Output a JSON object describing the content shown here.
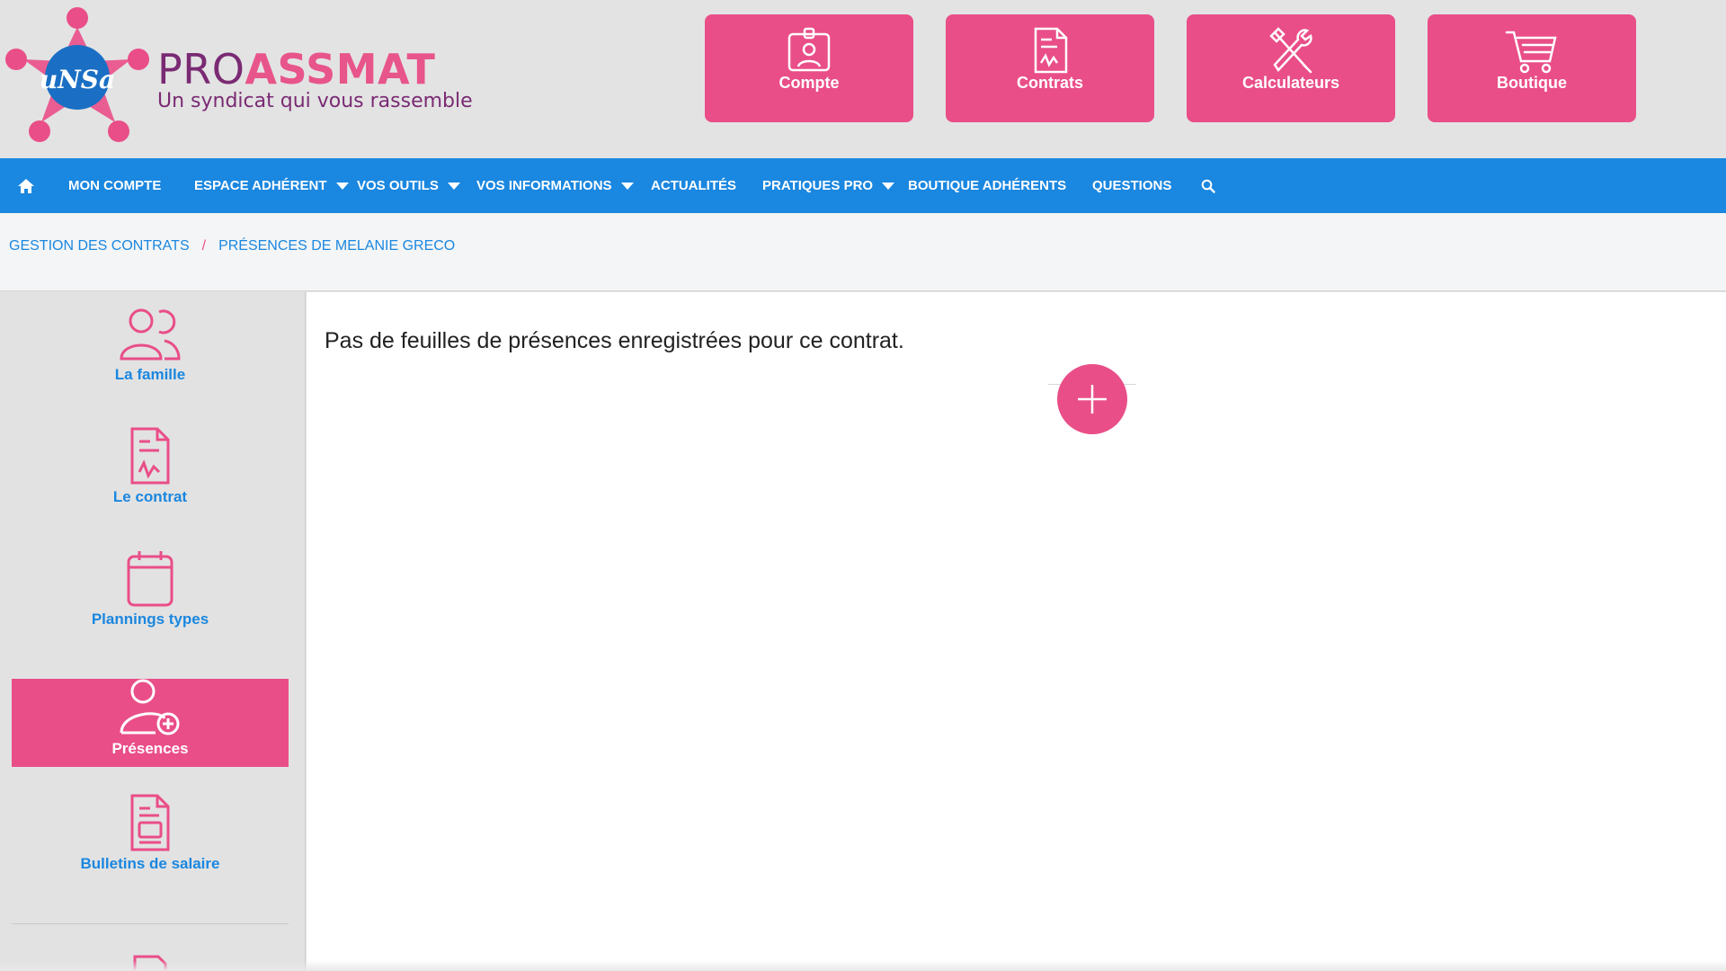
{
  "header": {
    "logo_text": "uNSa",
    "brand_pro": "PRO",
    "brand_assmat": "ASSMAT",
    "tagline": "Un syndicat qui vous rassemble",
    "quick_buttons": [
      {
        "label": "Compte",
        "icon": "id-badge-icon"
      },
      {
        "label": "Contrats",
        "icon": "contract-document-icon"
      },
      {
        "label": "Calculateurs",
        "icon": "tools-icon"
      },
      {
        "label": "Boutique",
        "icon": "shopping-cart-icon"
      }
    ]
  },
  "nav": {
    "home_icon": "home-icon",
    "items": [
      {
        "label": "MON COMPTE",
        "dropdown": false
      },
      {
        "label": "ESPACE ADHÉRENT",
        "dropdown": true
      },
      {
        "label": "VOS OUTILS",
        "dropdown": true
      },
      {
        "label": "VOS INFORMATIONS",
        "dropdown": true
      },
      {
        "label": "ACTUALITÉS",
        "dropdown": false
      },
      {
        "label": "PRATIQUES PRO",
        "dropdown": true
      },
      {
        "label": "BOUTIQUE ADHÉRENTS",
        "dropdown": false
      },
      {
        "label": "QUESTIONS",
        "dropdown": false
      }
    ],
    "search_icon": "search-icon"
  },
  "breadcrumb": {
    "items": [
      "GESTION DES CONTRATS",
      "PRÉSENCES DE MELANIE GRECO"
    ],
    "separator": "/"
  },
  "sidebar": {
    "items": [
      {
        "label": "La famille",
        "icon": "family-icon",
        "active": false
      },
      {
        "label": "Le contrat",
        "icon": "contract-icon",
        "active": false
      },
      {
        "label": "Plannings types",
        "icon": "calendar-icon",
        "active": false
      },
      {
        "label": "Présences",
        "icon": "person-add-icon",
        "active": true
      },
      {
        "label": "Bulletins de salaire",
        "icon": "payslip-icon",
        "active": false
      }
    ]
  },
  "main": {
    "empty_message": "Pas de feuilles de présences enregistrées pour ce contrat.",
    "add_button_icon": "plus-icon"
  },
  "colors": {
    "pink": "#e94e88",
    "blue": "#1a87e0",
    "purple": "#7a2a73",
    "header_bg": "#e3e3e3"
  }
}
